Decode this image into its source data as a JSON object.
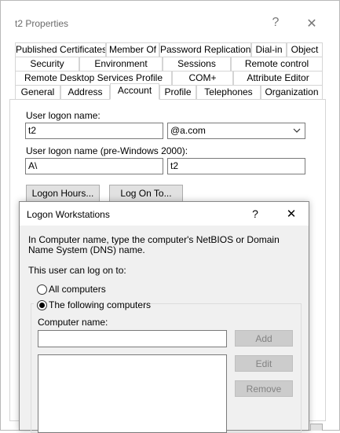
{
  "window": {
    "title": "t2 Properties",
    "help_glyph": "?",
    "close_glyph": "✕"
  },
  "tabs": {
    "row1": [
      "Published Certificates",
      "Member Of",
      "Password Replication",
      "Dial-in",
      "Object"
    ],
    "row2": [
      "Security",
      "Environment",
      "Sessions",
      "Remote control"
    ],
    "row3": [
      "Remote Desktop Services Profile",
      "COM+",
      "Attribute Editor"
    ],
    "row4": [
      "General",
      "Address",
      "Account",
      "Profile",
      "Telephones",
      "Organization"
    ],
    "active": "Account"
  },
  "account": {
    "logon_name_label": "User logon name:",
    "logon_name_value": "t2",
    "domain_value": "@a.com",
    "pre2000_label": "User logon name (pre-Windows 2000):",
    "pre2000_domain_value": "A\\",
    "pre2000_user_value": "t2",
    "logon_hours_button": "Logon Hours...",
    "logon_to_button": "Log On To..."
  },
  "dialog": {
    "title": "Logon Workstations",
    "help_glyph": "?",
    "close_glyph": "✕",
    "instruction": "In Computer name, type the computer's NetBIOS or Domain Name System (DNS) name.",
    "can_logon_label": "This user can log on to:",
    "radio_all": "All computers",
    "radio_following": "The following computers",
    "selected_radio": "following",
    "computer_name_label": "Computer name:",
    "computer_name_value": "",
    "add_button": "Add",
    "edit_button": "Edit",
    "remove_button": "Remove"
  }
}
